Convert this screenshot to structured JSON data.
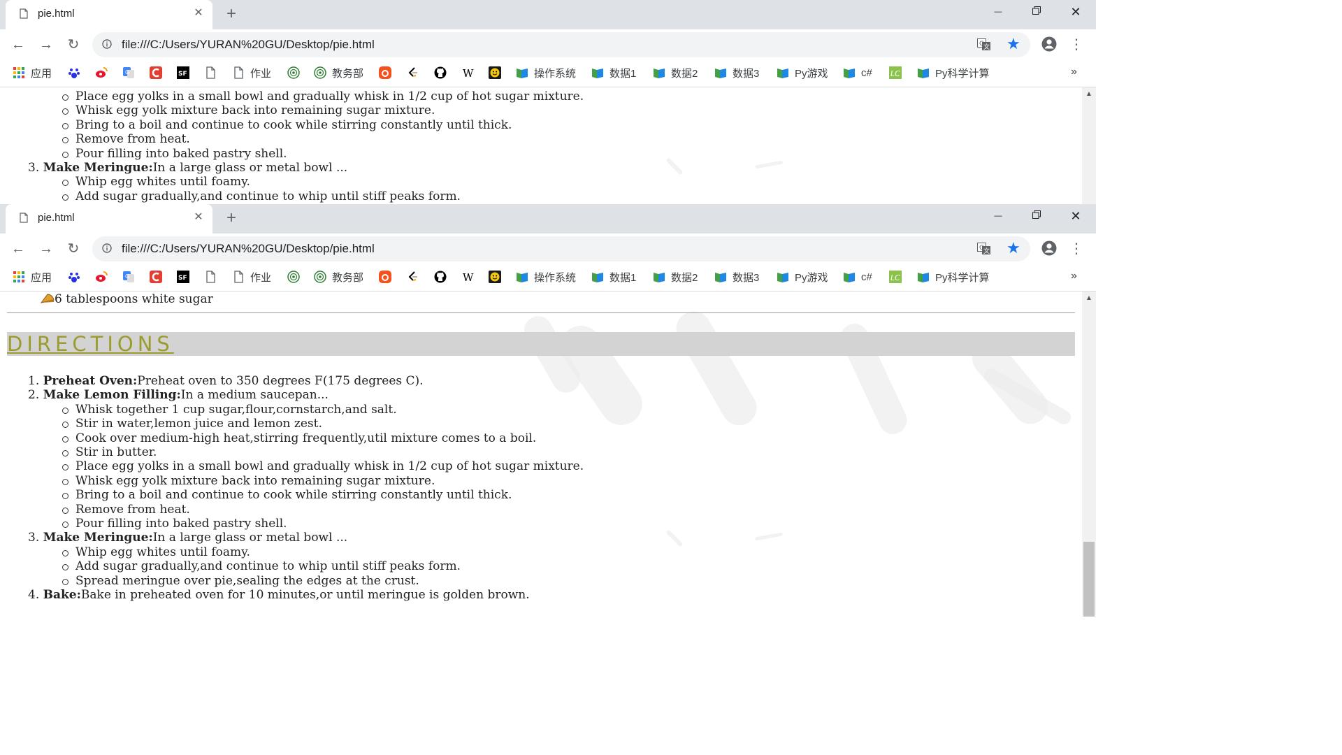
{
  "browser": {
    "tab_title": "pie.html",
    "url": "file:///C:/Users/YURAN%20GU/Desktop/pie.html",
    "bookmarks": [
      {
        "label": "应用",
        "icon": "apps-grid-icon",
        "color": "#e94235"
      },
      {
        "label": "",
        "icon": "baidu-paw-icon",
        "color": "#2932e1"
      },
      {
        "label": "",
        "icon": "weibo-icon",
        "color": "#e6162d"
      },
      {
        "label": "",
        "icon": "google-translate-icon",
        "color": "#4285f4"
      },
      {
        "label": "",
        "icon": "csdn-icon",
        "color": "#e33e33"
      },
      {
        "label": "",
        "icon": "segmentfault-icon",
        "color": "#000000"
      },
      {
        "label": "",
        "icon": "page-icon",
        "color": "#5f6368"
      },
      {
        "label": "作业",
        "icon": "page-icon",
        "color": "#5f6368"
      },
      {
        "label": "",
        "icon": "school-emblem-icon",
        "color": "#2e7d32"
      },
      {
        "label": "教务部",
        "icon": "school-emblem-icon",
        "color": "#2e7d32"
      },
      {
        "label": "",
        "icon": "orange-app-icon",
        "color": "#f4511e"
      },
      {
        "label": "",
        "icon": "leetcode-icon",
        "color": "#f89f1b"
      },
      {
        "label": "",
        "icon": "github-icon",
        "color": "#000000"
      },
      {
        "label": "",
        "icon": "wikipedia-icon",
        "color": "#000000"
      },
      {
        "label": "",
        "icon": "smiley-icon",
        "color": "#f2c811"
      },
      {
        "label": "操作系统",
        "icon": "folder-flag-icon",
        "color": "#1e88e5"
      },
      {
        "label": "数据1",
        "icon": "folder-flag-icon",
        "color": "#1e88e5"
      },
      {
        "label": "数据2",
        "icon": "folder-flag-icon",
        "color": "#1e88e5"
      },
      {
        "label": "数据3",
        "icon": "folder-flag-icon",
        "color": "#1e88e5"
      },
      {
        "label": "Py游戏",
        "icon": "folder-flag-icon",
        "color": "#1e88e5"
      },
      {
        "label": "c#",
        "icon": "folder-flag-icon",
        "color": "#1e88e5"
      },
      {
        "label": "",
        "icon": "lc-square-icon",
        "color": "#8bc34a"
      },
      {
        "label": "Py科学计算",
        "icon": "folder-flag-icon",
        "color": "#1e88e5"
      }
    ],
    "more_label": "»"
  },
  "page": {
    "ingredient_last": "6 tablespoons white sugar",
    "directions_heading": "DIRECTIONS",
    "heading_color": "#9c9c2e",
    "steps": [
      {
        "title": "Preheat Oven:",
        "text": "Preheat oven to 350 degrees F(175 degrees C).",
        "subs": []
      },
      {
        "title": "Make Lemon Filling:",
        "text": "In a medium saucepan...",
        "subs": [
          "Whisk together 1 cup sugar,flour,cornstarch,and salt.",
          "Stir in water,lemon juice and lemon zest.",
          "Cook over medium-high heat,stirring frequently,util mixture comes to a boil.",
          "Stir in butter.",
          "Place egg yolks in a small bowl and gradually whisk in 1/2 cup of hot sugar mixture.",
          "Whisk egg yolk mixture back into remaining sugar mixture.",
          "Bring to a boil and continue to cook while stirring constantly until thick.",
          "Remove from heat.",
          "Pour filling into baked pastry shell."
        ]
      },
      {
        "title": "Make Meringue:",
        "text": "In a large glass or metal bowl ...",
        "subs": [
          "Whip egg whites until foamy.",
          "Add sugar gradually,and continue to whip until stiff peaks form.",
          "Spread meringue over pie,sealing the edges at the crust."
        ]
      },
      {
        "title": "Bake:",
        "text": "Bake in preheated oven for 10 minutes,or until meringue is golden brown.",
        "subs": []
      }
    ]
  },
  "window1": {
    "scroll_thumb": {
      "top_frac": 0.0,
      "size_frac": 0.0
    },
    "lines": [
      {
        "kind": "sub",
        "text": "Place egg yolks in a small bowl and gradually whisk in 1/2 cup of hot sugar mixture."
      },
      {
        "kind": "sub",
        "text": "Whisk egg yolk mixture back into remaining sugar mixture."
      },
      {
        "kind": "sub",
        "text": "Bring to a boil and continue to cook while stirring constantly until thick."
      },
      {
        "kind": "sub",
        "text": "Remove from heat."
      },
      {
        "kind": "sub",
        "text": "Pour filling into baked pastry shell."
      },
      {
        "kind": "step",
        "num": "3.",
        "title": "Make Meringue:",
        "text": "In a large glass or metal bowl ..."
      },
      {
        "kind": "sub",
        "text": "Whip egg whites until foamy."
      },
      {
        "kind": "sub",
        "text": "Add sugar gradually,and continue to whip until stiff peaks form."
      }
    ]
  }
}
